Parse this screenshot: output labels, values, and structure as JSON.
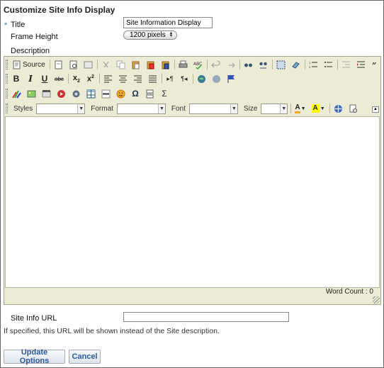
{
  "page": {
    "title": "Customize Site Info Display"
  },
  "form": {
    "required_marker": "*",
    "title_label": "Title",
    "title_value": "Site Information Display",
    "frame_height_label": "Frame Height",
    "frame_height_value": "1200 pixels",
    "description_label": "Description",
    "site_info_url_label": "Site Info URL",
    "site_info_url_value": "",
    "help_text": "If specified, this URL will be shown instead of the Site description."
  },
  "editor": {
    "source_label": "Source",
    "styles_label": "Styles",
    "format_label": "Format",
    "font_label": "Font",
    "size_label": "Size",
    "word_count": "Word Count : 0",
    "row1_icons": [
      "document-icon",
      "preview-icon",
      "templates-icon",
      "cut-icon",
      "copy-icon",
      "paste-icon",
      "paste-text-icon",
      "paste-word-icon",
      "print-icon",
      "spellcheck-icon",
      "undo-icon",
      "redo-icon",
      "find-icon",
      "replace-icon",
      "select-all-icon",
      "remove-format-icon",
      "numbered-list-icon",
      "bulleted-list-icon",
      "outdent-icon",
      "indent-icon",
      "blockquote-icon",
      "creatediv-icon"
    ],
    "row2_icons": [
      "bold-icon",
      "italic-icon",
      "underline-icon",
      "strikethrough-icon",
      "subscript-icon",
      "superscript-icon",
      "align-left-icon",
      "align-center-icon",
      "align-right-icon",
      "justify-icon",
      "ltr-icon",
      "rtl-icon",
      "link-icon",
      "unlink-icon",
      "anchor-icon"
    ],
    "row3_icons": [
      "movie-icon",
      "image-icon",
      "flash-icon",
      "media-icon",
      "table-icon",
      "horizontal-rule-icon",
      "smiley-icon",
      "special-char-icon",
      "page-break-icon",
      "sigma-icon"
    ],
    "row4_icons": [
      "text-color-icon",
      "bg-color-icon",
      "maximize-icon",
      "show-blocks-icon"
    ]
  },
  "buttons": {
    "update": "Update Options",
    "cancel": "Cancel"
  }
}
